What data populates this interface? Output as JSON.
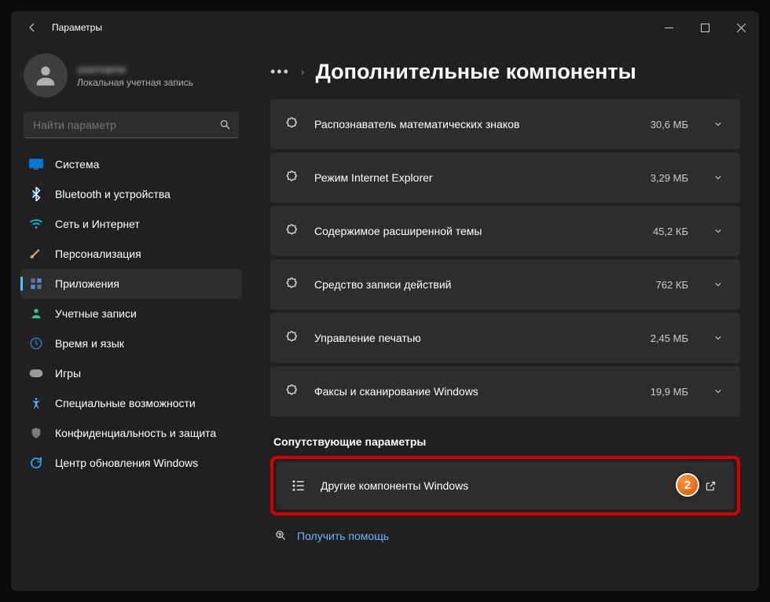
{
  "app_title": "Параметры",
  "account": {
    "name": "username",
    "subtitle": "Локальная учетная запись"
  },
  "search": {
    "placeholder": "Найти параметр"
  },
  "nav": {
    "items": [
      {
        "label": "Система",
        "icon": "system",
        "color": "#0078d4"
      },
      {
        "label": "Bluetooth и устройства",
        "icon": "bluetooth",
        "color": "#0078d4"
      },
      {
        "label": "Сеть и Интернет",
        "icon": "wifi",
        "color": "#00b7c3"
      },
      {
        "label": "Персонализация",
        "icon": "brush",
        "color": "#e3a76f"
      },
      {
        "label": "Приложения",
        "icon": "apps",
        "color": "#5a5a7a",
        "selected": true
      },
      {
        "label": "Учетные записи",
        "icon": "person",
        "color": "#2ac98f"
      },
      {
        "label": "Время и язык",
        "icon": "clock-globe",
        "color": "#3a74c4"
      },
      {
        "label": "Игры",
        "icon": "gamepad",
        "color": "#9a9a9a"
      },
      {
        "label": "Специальные возможности",
        "icon": "accessibility",
        "color": "#5fb4ff"
      },
      {
        "label": "Конфиденциальность и защита",
        "icon": "shield",
        "color": "#7a7a7a"
      },
      {
        "label": "Центр обновления Windows",
        "icon": "update",
        "color": "#2d9cdb"
      }
    ]
  },
  "page": {
    "title": "Дополнительные компоненты",
    "components": [
      {
        "label": "Распознаватель математических знаков",
        "size": "30,6 МБ"
      },
      {
        "label": "Режим Internet Explorer",
        "size": "3,29 МБ"
      },
      {
        "label": "Содержимое расширенной темы",
        "size": "45,2 КБ"
      },
      {
        "label": "Средство записи действий",
        "size": "762 КБ"
      },
      {
        "label": "Управление печатью",
        "size": "2,45 МБ"
      },
      {
        "label": "Факсы и сканирование Windows",
        "size": "19,9 МБ"
      }
    ],
    "related_header": "Сопутствующие параметры",
    "related": {
      "label": "Другие компоненты Windows"
    },
    "help_label": "Получить помощь",
    "annotation_badge": "2"
  }
}
